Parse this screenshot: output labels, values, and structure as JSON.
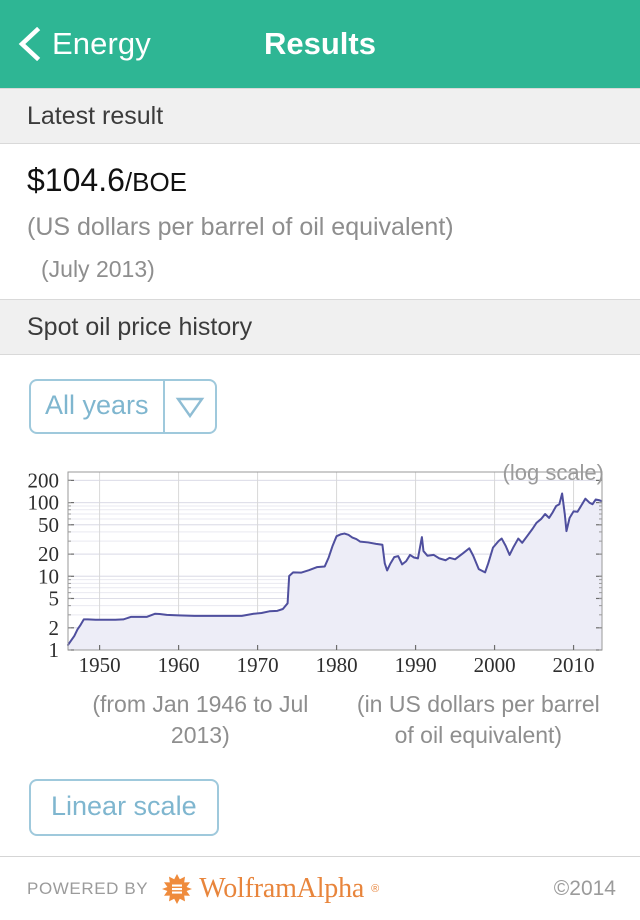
{
  "navbar": {
    "back_label": "Energy",
    "title": "Results",
    "back_icon": "chevron-left-icon",
    "background_color": "#2eb694"
  },
  "sections": {
    "latest_result": {
      "header": "Latest result",
      "value": "$104.6",
      "unit": "/BOE",
      "description": "(US dollars per barrel of oil equivalent)",
      "date": "(July 2013)"
    },
    "history": {
      "header": "Spot oil price history",
      "range_selector": {
        "label": "All years",
        "caret_icon": "chevron-down-icon"
      },
      "scale_note": "(log scale)",
      "caption_left": "(from Jan 1946 to Jul 2013)",
      "caption_right": "(in US dollars per barrel of oil equivalent)",
      "toggle_button": "Linear scale"
    }
  },
  "footer": {
    "powered_by": "POWERED BY",
    "brand": "WolframAlpha",
    "registered_mark": "®",
    "copyright": "©2014",
    "logo_icon": "wolfram-starburst-icon",
    "brand_color": "#e8853c"
  },
  "chart_data": {
    "type": "line",
    "title": "Spot oil price history",
    "xlabel": "(from Jan 1946 to Jul 2013)",
    "ylabel": "(in US dollars per barrel of oil equivalent)",
    "scale": "log",
    "grid": true,
    "legend": null,
    "line_color": "#4f4f9e",
    "fill_color": "#ededf7",
    "xlim": [
      1946,
      2013.6
    ],
    "ylim": [
      1,
      260
    ],
    "xticks": [
      1950,
      1960,
      1970,
      1980,
      1990,
      2000,
      2010
    ],
    "yticks": [
      1,
      2,
      5,
      10,
      20,
      50,
      100,
      200
    ],
    "ytick_labels": [
      "1",
      "2",
      "5",
      "10",
      "20",
      "50",
      "100",
      "200"
    ],
    "x": [
      1946.0,
      1946.4,
      1946.8,
      1947.2,
      1947.6,
      1948.0,
      1948.5,
      1949.5,
      1950.5,
      1952.0,
      1953.0,
      1954.0,
      1955.0,
      1956.0,
      1957.0,
      1957.6,
      1958.5,
      1960.0,
      1962.0,
      1964.0,
      1966.0,
      1968.0,
      1969.5,
      1970.5,
      1971.5,
      1972.5,
      1973.2,
      1973.8,
      1974.0,
      1974.5,
      1975.5,
      1976.5,
      1977.5,
      1978.5,
      1979.0,
      1979.5,
      1980.0,
      1980.5,
      1981.0,
      1981.5,
      1982.0,
      1982.5,
      1983.0,
      1984.0,
      1985.0,
      1985.8,
      1986.1,
      1986.4,
      1986.8,
      1987.3,
      1987.8,
      1988.3,
      1988.8,
      1989.3,
      1989.8,
      1990.3,
      1990.8,
      1991.0,
      1991.5,
      1992.3,
      1993.0,
      1993.8,
      1994.3,
      1995.0,
      1996.0,
      1996.8,
      1997.3,
      1998.0,
      1998.8,
      1999.2,
      1999.8,
      2000.5,
      2000.9,
      2001.4,
      2001.9,
      2002.4,
      2003.0,
      2003.5,
      2004.2,
      2004.8,
      2005.3,
      2005.9,
      2006.4,
      2006.9,
      2007.3,
      2007.8,
      2008.2,
      2008.55,
      2008.9,
      2009.1,
      2009.5,
      2010.0,
      2010.5,
      2011.0,
      2011.5,
      2012.0,
      2012.4,
      2012.8,
      2013.2,
      2013.55
    ],
    "y": [
      1.17,
      1.35,
      1.55,
      1.9,
      2.2,
      2.6,
      2.6,
      2.57,
      2.57,
      2.57,
      2.6,
      2.82,
      2.82,
      2.82,
      3.1,
      3.08,
      3.0,
      2.95,
      2.9,
      2.9,
      2.9,
      2.9,
      3.1,
      3.18,
      3.35,
      3.4,
      3.6,
      4.3,
      10.1,
      11.3,
      11.2,
      12.1,
      13.3,
      13.6,
      18.0,
      26.0,
      35.0,
      37.0,
      38.0,
      36.5,
      33.5,
      32.0,
      29.5,
      28.8,
      27.5,
      26.8,
      15.0,
      12.0,
      14.8,
      18.2,
      18.8,
      14.5,
      16.0,
      19.5,
      18.0,
      17.5,
      34.0,
      22.0,
      19.0,
      19.5,
      17.5,
      16.5,
      17.8,
      17.0,
      20.5,
      24.0,
      19.0,
      12.5,
      11.3,
      15.0,
      24.5,
      30.0,
      32.5,
      26.0,
      19.5,
      25.0,
      32.5,
      28.5,
      36.0,
      44.0,
      53.0,
      60.0,
      70.0,
      62.0,
      72.0,
      90.0,
      95.0,
      133.0,
      68.0,
      41.0,
      62.0,
      76.0,
      75.0,
      92.0,
      113.0,
      100.0,
      95.0,
      110.0,
      108.0,
      105.0
    ]
  }
}
